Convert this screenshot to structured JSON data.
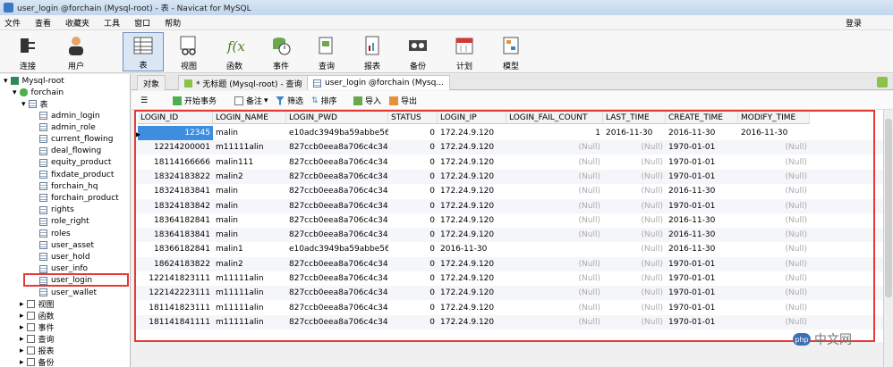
{
  "window": {
    "title": "user_login @forchain (Mysql-root) - 表 - Navicat for MySQL"
  },
  "menu": {
    "items": [
      "文件",
      "查看",
      "收藏夹",
      "工具",
      "窗口",
      "帮助"
    ],
    "login": "登录"
  },
  "toolbar": {
    "items": [
      "连接",
      "用户",
      "表",
      "视图",
      "函数",
      "事件",
      "查询",
      "报表",
      "备份",
      "计划",
      "模型"
    ]
  },
  "sidebar": {
    "connection": "Mysql-root",
    "database": "forchain",
    "tables_label": "表",
    "tables": [
      "admin_login",
      "admin_role",
      "current_flowing",
      "deal_flowing",
      "equity_product",
      "fixdate_product",
      "forchain_hq",
      "forchain_product",
      "rights",
      "role_right",
      "roles",
      "user_asset",
      "user_hold",
      "user_info",
      "user_login",
      "user_wallet"
    ],
    "groups": [
      "视图",
      "函数",
      "事件",
      "查询",
      "报表",
      "备份"
    ]
  },
  "tabs": [
    "对象",
    "* 无标题 (Mysql-root) - 查询",
    "user_login @forchain (Mysq..."
  ],
  "subtoolbar": {
    "begin": "开始事务",
    "memo": "备注",
    "filter": "筛选",
    "sort": "排序",
    "import": "导入",
    "export": "导出"
  },
  "grid": {
    "columns": [
      "LOGIN_ID",
      "LOGIN_NAME",
      "LOGIN_PWD",
      "STATUS",
      "LOGIN_IP",
      "LOGIN_FAIL_COUNT",
      "LAST_TIME",
      "CREATE_TIME",
      "MODIFY_TIME"
    ],
    "rows": [
      [
        "12345",
        "malin",
        "e10adc3949ba59abbe56e",
        "0",
        "172.24.9.120",
        "1",
        "2016-11-30",
        "2016-11-30",
        "2016-11-30"
      ],
      [
        "12214200001",
        "m11111alin",
        "827ccb0eea8a706c4c34a1",
        "0",
        "172.24.9.120",
        "(Null)",
        "(Null)",
        "1970-01-01",
        "(Null)"
      ],
      [
        "18114166666",
        "malin111",
        "827ccb0eea8a706c4c34a1",
        "0",
        "172.24.9.120",
        "(Null)",
        "(Null)",
        "1970-01-01",
        "(Null)"
      ],
      [
        "18324183822",
        "malin2",
        "827ccb0eea8a706c4c34a1",
        "0",
        "172.24.9.120",
        "(Null)",
        "(Null)",
        "1970-01-01",
        "(Null)"
      ],
      [
        "18324183841",
        "malin",
        "827ccb0eea8a706c4c34a1",
        "0",
        "172.24.9.120",
        "(Null)",
        "(Null)",
        "2016-11-30",
        "(Null)"
      ],
      [
        "18324183842",
        "malin",
        "827ccb0eea8a706c4c34a1",
        "0",
        "172.24.9.120",
        "(Null)",
        "(Null)",
        "1970-01-01",
        "(Null)"
      ],
      [
        "18364182841",
        "malin",
        "827ccb0eea8a706c4c34a1",
        "0",
        "172.24.9.120",
        "(Null)",
        "(Null)",
        "2016-11-30",
        "(Null)"
      ],
      [
        "18364183841",
        "malin",
        "827ccb0eea8a706c4c34a1",
        "0",
        "172.24.9.120",
        "(Null)",
        "(Null)",
        "2016-11-30",
        "(Null)"
      ],
      [
        "18366182841",
        "malin1",
        "e10adc3949ba59abbe56e",
        "0",
        "2016-11-30",
        "",
        "(Null)",
        "2016-11-30",
        "(Null)"
      ],
      [
        "18624183822",
        "malin2",
        "827ccb0eea8a706c4c34a1",
        "0",
        "172.24.9.120",
        "(Null)",
        "(Null)",
        "1970-01-01",
        "(Null)"
      ],
      [
        "122141823111",
        "m11111alin",
        "827ccb0eea8a706c4c34a1",
        "0",
        "172.24.9.120",
        "(Null)",
        "(Null)",
        "1970-01-01",
        "(Null)"
      ],
      [
        "122142223111",
        "m11111alin",
        "827ccb0eea8a706c4c34a1",
        "0",
        "172.24.9.120",
        "(Null)",
        "(Null)",
        "1970-01-01",
        "(Null)"
      ],
      [
        "181141823111",
        "m11111alin",
        "827ccb0eea8a706c4c34a1",
        "0",
        "172.24.9.120",
        "(Null)",
        "(Null)",
        "1970-01-01",
        "(Null)"
      ],
      [
        "181141841111",
        "m11111alin",
        "827ccb0eea8a706c4c34a1",
        "0",
        "172.24.9.120",
        "(Null)",
        "(Null)",
        "1970-01-01",
        "(Null)"
      ]
    ]
  },
  "watermark": {
    "logo": "php",
    "text": "中文网"
  }
}
